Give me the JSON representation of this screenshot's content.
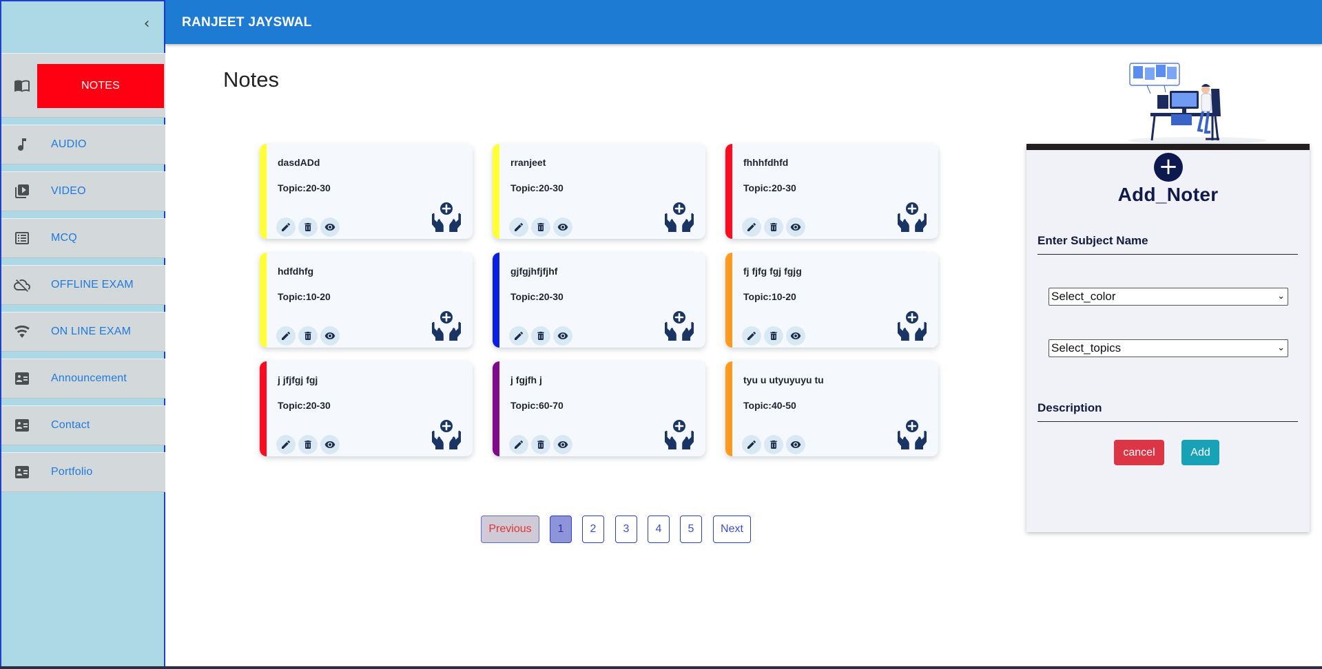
{
  "header": {
    "title": "RANJEET JAYSWAL"
  },
  "sidebar": {
    "collapse_icon": "chevron-left-icon",
    "items": [
      {
        "label": "NOTES",
        "icon": "book-icon",
        "active": true
      },
      {
        "label": "AUDIO",
        "icon": "music-note-icon"
      },
      {
        "label": "VIDEO",
        "icon": "video-library-icon"
      },
      {
        "label": "MCQ",
        "icon": "list-icon"
      },
      {
        "label": "OFFLINE EXAM",
        "icon": "cloud-off-icon"
      },
      {
        "label": "ON LINE EXAM",
        "icon": "wifi-icon"
      },
      {
        "label": "Announcement",
        "icon": "contact-card-icon"
      },
      {
        "label": "Contact",
        "icon": "contact-card-icon"
      },
      {
        "label": "Portfolio",
        "icon": "contact-card-icon"
      }
    ]
  },
  "main": {
    "page_title": "Notes",
    "cards": [
      {
        "title": "dasdADd",
        "topic": "Topic:20-30",
        "color": "#ffff33"
      },
      {
        "title": "rranjeet",
        "topic": "Topic:20-30",
        "color": "#ffff33"
      },
      {
        "title": "fhhhfdhfd",
        "topic": "Topic:20-30",
        "color": "#ff0a1e"
      },
      {
        "title": "hdfdhfg",
        "topic": "Topic:10-20",
        "color": "#ffff33"
      },
      {
        "title": "gjfgjhfjfjhf",
        "topic": "Topic:20-30",
        "color": "#0a1ee6"
      },
      {
        "title": "fj fjfg fgj fgjg",
        "topic": "Topic:10-20",
        "color": "#ff9a1e"
      },
      {
        "title": "j jfjfgj fgj",
        "topic": "Topic:20-30",
        "color": "#ff0a1e"
      },
      {
        "title": "j fgjfh j",
        "topic": "Topic:60-70",
        "color": "#800a8c"
      },
      {
        "title": "tyu u utyuyuyu tu",
        "topic": "Topic:40-50",
        "color": "#ff9a1e"
      }
    ],
    "card_icons": {
      "edit": "pencil-icon",
      "delete": "trash-icon",
      "view": "eye-icon",
      "badge": "hands-plus-icon"
    },
    "pagination": {
      "previous": "Previous",
      "pages": [
        "1",
        "2",
        "3",
        "4",
        "5"
      ],
      "current": "1",
      "next": "Next"
    }
  },
  "panel": {
    "add_icon": "plus-circle-icon",
    "title": "Add_Noter",
    "subject_label": "Enter Subject Name",
    "color_select": "Select_color",
    "topics_select": "Select_topics",
    "description_label": "Description",
    "cancel_label": "cancel",
    "add_label": "Add"
  },
  "colors": {
    "header": "#1e7bd3",
    "sidebar": "#add8e6",
    "active_nav": "#ff0012",
    "nav_text": "#1f7ae0",
    "cancel": "#dc3545",
    "add": "#17a2b8"
  }
}
